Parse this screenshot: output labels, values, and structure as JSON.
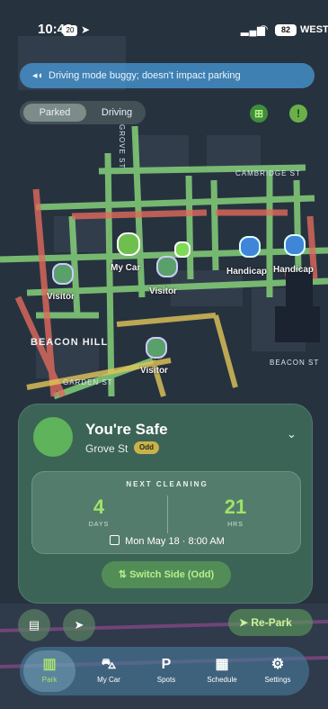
{
  "status_bar": {
    "time": "10:48",
    "notification_badge": "20",
    "battery": "82",
    "corner_text": "WEST"
  },
  "banner": {
    "text": "Driving mode buggy; doesn't impact parking"
  },
  "mode_toggle": {
    "options": [
      "Parked",
      "Driving"
    ],
    "selected": "Parked"
  },
  "map": {
    "street_labels": [
      "CAMBRIDGE ST",
      "BEACON HILL",
      "BEACON ST",
      "GROVE ST",
      "GARDEN ST"
    ],
    "pins": [
      {
        "label": "My Car",
        "type": "car"
      },
      {
        "label": "Visitor",
        "type": "visitor"
      },
      {
        "label": "Visitor",
        "type": "visitor"
      },
      {
        "label": "Visitor",
        "type": "visitor"
      },
      {
        "label": "Handicap",
        "type": "handicap"
      },
      {
        "label": "Handicap",
        "type": "handicap"
      }
    ],
    "colors": {
      "road_green": "#86d07a",
      "road_red": "#e06a5c",
      "road_yellow": "#e2c65a",
      "block": "#2b3442"
    }
  },
  "status_card": {
    "title": "You're Safe",
    "street": "Grove St",
    "side_badge": "Odd",
    "next_cleaning_label": "NEXT CLEANING",
    "days_value": "4",
    "days_unit": "DAYS",
    "hours_value": "21",
    "hours_unit": "HRS",
    "date_text": "Mon May 18 · 8:00 AM",
    "switch_side_label": "Switch Side (Odd)"
  },
  "actions": {
    "repark_label": "Re-Park"
  },
  "tabs": [
    {
      "label": "Park",
      "icon": "map-icon",
      "active": true
    },
    {
      "label": "My Car",
      "icon": "car-icon",
      "active": false
    },
    {
      "label": "Spots",
      "icon": "parking-icon",
      "active": false
    },
    {
      "label": "Schedule",
      "icon": "calendar-icon",
      "active": false
    },
    {
      "label": "Settings",
      "icon": "gear-icon",
      "active": false
    }
  ],
  "accent_color": "#a7e36d"
}
